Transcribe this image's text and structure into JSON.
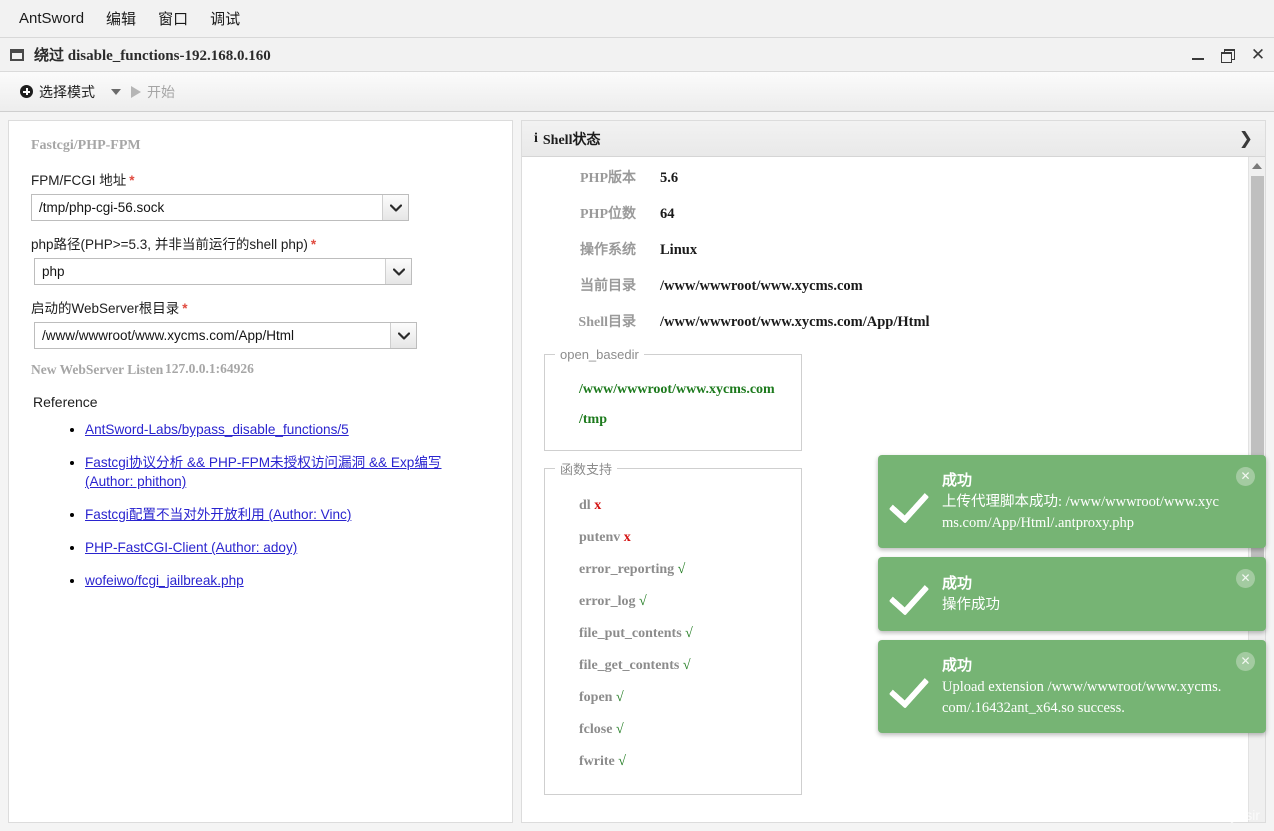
{
  "menubar": {
    "items": [
      {
        "label": "AntSword",
        "name": "menu-antsword"
      },
      {
        "label": "编辑",
        "name": "menu-edit"
      },
      {
        "label": "窗口",
        "name": "menu-window"
      },
      {
        "label": "调试",
        "name": "menu-debug"
      }
    ]
  },
  "window": {
    "title": "绕过 disable_functions-192.168.0.160",
    "minimize_label": "",
    "maximize_label": "",
    "close_label": "✕"
  },
  "toolbar": {
    "select_mode_label": "选择模式",
    "start_label": "开始"
  },
  "left_panel": {
    "group_title": "Fastcgi/PHP-FPM",
    "fields": [
      {
        "label": "FPM/FCGI 地址",
        "required_mark": "*",
        "value": "/tmp/php-cgi-56.sock",
        "name": "fpm-fcgi-address"
      },
      {
        "label": "php路径(PHP>=5.3, 并非当前运行的shell php)",
        "required_mark": "*",
        "value": "php",
        "name": "php-path"
      },
      {
        "label": "启动的WebServer根目录",
        "required_mark": "*",
        "value": "/www/wwwroot/www.xycms.com/App/Html",
        "name": "webserver-root"
      }
    ],
    "listen_key": "New WebServer Listen",
    "listen_value": "127.0.0.1:64926",
    "reference_heading": "Reference",
    "reference_links": [
      "AntSword-Labs/bypass_disable_functions/5",
      "Fastcgi协议分析 && PHP-FPM未授权访问漏洞 && Exp编写 (Author: phithon)",
      "Fastcgi配置不当对外开放利用 (Author: Vinc)",
      "PHP-FastCGI-Client (Author: adoy)",
      "wofeiwo/fcgi_jailbreak.php"
    ]
  },
  "shell_status": {
    "header_title": "Shell状态",
    "header_icon": "i",
    "header_chevron": "❯",
    "rows": [
      {
        "key": "PHP版本",
        "value": "5.6"
      },
      {
        "key": "PHP位数",
        "value": "64"
      },
      {
        "key": "操作系统",
        "value": "Linux"
      },
      {
        "key": "当前目录",
        "value": "/www/wwwroot/www.xycms.com"
      },
      {
        "key": "Shell目录",
        "value": "/www/wwwroot/www.xycms.com/App/Html"
      }
    ],
    "open_basedir": {
      "legend": "open_basedir",
      "items": [
        "/www/wwwroot/www.xycms.com",
        "/tmp"
      ]
    },
    "function_support": {
      "legend": "函数支持",
      "items": [
        {
          "name": "dl",
          "status": "x",
          "supported": false
        },
        {
          "name": "putenv",
          "status": "x",
          "supported": false
        },
        {
          "name": "error_reporting",
          "status": "√",
          "supported": true
        },
        {
          "name": "error_log",
          "status": "√",
          "supported": true
        },
        {
          "name": "file_put_contents",
          "status": "√",
          "supported": true
        },
        {
          "name": "file_get_contents",
          "status": "√",
          "supported": true
        },
        {
          "name": "fopen",
          "status": "√",
          "supported": true
        },
        {
          "name": "fclose",
          "status": "√",
          "supported": true
        },
        {
          "name": "fwrite",
          "status": "√",
          "supported": true
        }
      ]
    }
  },
  "toasts": [
    {
      "title": "成功",
      "message": "上传代理脚本成功: /www/wwwroot/www.xycms.com/App/Html/.antproxy.php",
      "close_label": "✕"
    },
    {
      "title": "成功",
      "message": "操作成功",
      "close_label": "✕"
    },
    {
      "title": "成功",
      "message": "Upload extension /www/wwwroot/www.xycms.com/.16432ant_x64.so success.",
      "close_label": "✕"
    }
  ],
  "watermark": "CSDN @夜yesir",
  "colors": {
    "toast_green": "#76b474",
    "link_blue": "#2a24cf",
    "ok_green": "#1d7a1d",
    "error_red": "#d41111",
    "required_red": "#e04a3f"
  }
}
